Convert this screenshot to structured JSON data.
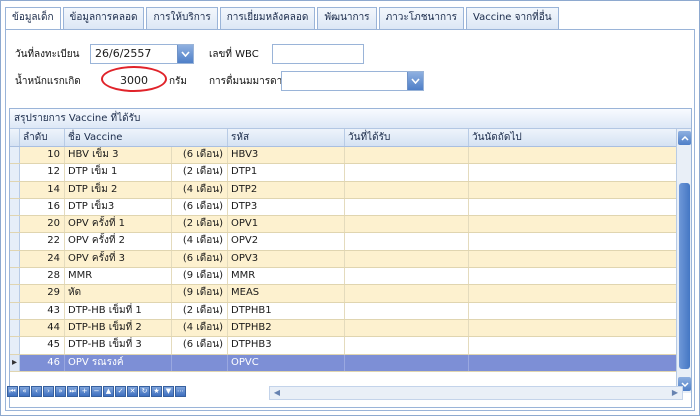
{
  "tabs": [
    "ข้อมูลเด็ก",
    "ข้อมูลการคลอด",
    "การให้บริการ",
    "การเยี่ยมหลังคลอด",
    "พัฒนาการ",
    "ภาวะโภชนาการ",
    "Vaccine จากที่อื่น"
  ],
  "form": {
    "reg_date_label": "วันที่ลงทะเบียน",
    "reg_date_value": "26/6/2557",
    "wbc_label": "เลขที่ WBC",
    "wbc_value": "",
    "weight_label": "น้ำหนักแรกเกิด",
    "weight_value": "3000",
    "weight_unit": "กรัม",
    "milk_label": "การดื่มนมมารดา",
    "milk_value": ""
  },
  "grid": {
    "title": "สรุปรายการ Vaccine ที่ได้รับ",
    "columns": [
      "ลำดับ",
      "ชื่อ Vaccine",
      "รหัส",
      "วันที่ได้รับ",
      "วันนัดถัดไป"
    ],
    "rows": [
      {
        "no": "10",
        "name": "HBV เข็ม 3",
        "dur": "(6 เดือน)",
        "code": "HBV3",
        "date": "",
        "next": ""
      },
      {
        "no": "12",
        "name": "DTP เข็ม 1",
        "dur": "(2 เดือน)",
        "code": "DTP1",
        "date": "",
        "next": ""
      },
      {
        "no": "14",
        "name": "DTP เข็ม 2",
        "dur": "(4 เดือน)",
        "code": "DTP2",
        "date": "",
        "next": ""
      },
      {
        "no": "16",
        "name": "DTP เข็ม3",
        "dur": "(6 เดือน)",
        "code": "DTP3",
        "date": "",
        "next": ""
      },
      {
        "no": "20",
        "name": "OPV ครั้งที่ 1",
        "dur": "(2 เดือน)",
        "code": "OPV1",
        "date": "",
        "next": ""
      },
      {
        "no": "22",
        "name": "OPV ครั้งที่ 2",
        "dur": "(4 เดือน)",
        "code": "OPV2",
        "date": "",
        "next": ""
      },
      {
        "no": "24",
        "name": "OPV ครั้งที่ 3",
        "dur": "(6 เดือน)",
        "code": "OPV3",
        "date": "",
        "next": ""
      },
      {
        "no": "28",
        "name": "MMR",
        "dur": "(9 เดือน)",
        "code": "MMR",
        "date": "",
        "next": ""
      },
      {
        "no": "29",
        "name": "หัด",
        "dur": "(9 เดือน)",
        "code": "MEAS",
        "date": "",
        "next": ""
      },
      {
        "no": "43",
        "name": "DTP-HB เข็มที่ 1",
        "dur": "(2 เดือน)",
        "code": "DTPHB1",
        "date": "",
        "next": ""
      },
      {
        "no": "44",
        "name": "DTP-HB เข็มที่ 2",
        "dur": "(4 เดือน)",
        "code": "DTPHB2",
        "date": "",
        "next": ""
      },
      {
        "no": "45",
        "name": "DTP-HB เข็มที่ 3",
        "dur": "(6 เดือน)",
        "code": "DTPHB3",
        "date": "",
        "next": ""
      },
      {
        "no": "46",
        "name": "OPV รณรงค์",
        "dur": "",
        "code": "OPVC",
        "date": "",
        "next": ""
      }
    ],
    "selected_row": 12
  },
  "colors": {
    "row_alt": "#fdf1cf",
    "row_selected": "#7d8fd6",
    "highlight_ring": "#e0232a",
    "accent_blue": "#4f7fc8"
  }
}
